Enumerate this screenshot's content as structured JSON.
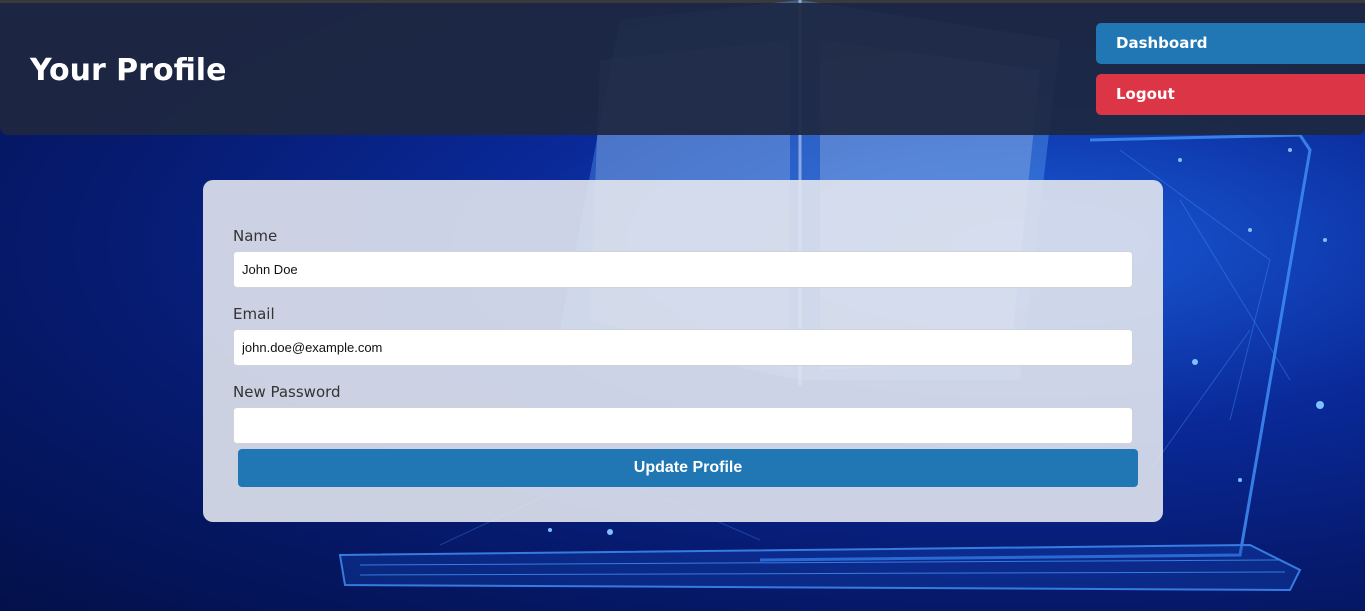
{
  "header": {
    "title": "Your Profile",
    "dashboard_label": "Dashboard",
    "logout_label": "Logout"
  },
  "form": {
    "name": {
      "label": "Name",
      "value": "John Doe"
    },
    "email": {
      "label": "Email",
      "value": "john.doe@example.com"
    },
    "password": {
      "label": "New Password",
      "value": ""
    },
    "submit_label": "Update Profile"
  },
  "colors": {
    "primary": "#2077b4",
    "danger": "#dc3545",
    "header_bg": "#1e2841",
    "background": "#061a6e"
  }
}
